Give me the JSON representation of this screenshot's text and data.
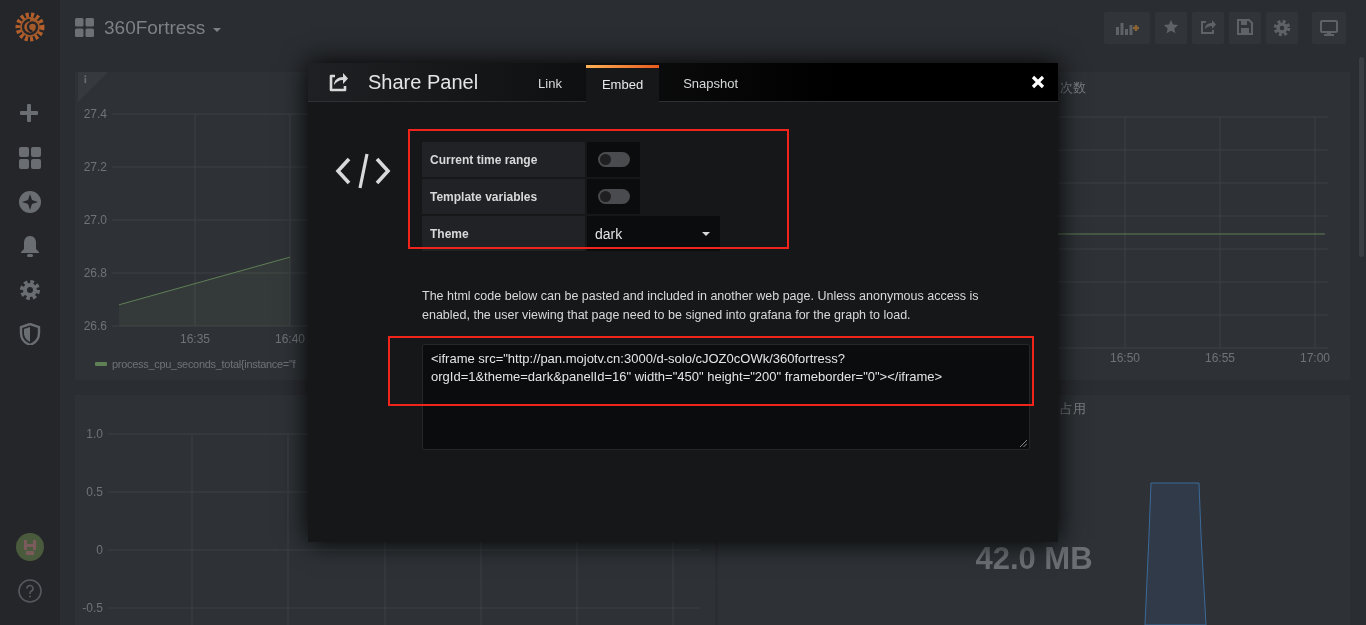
{
  "navbar": {
    "dashboard_title": "360Fortress"
  },
  "panels": [
    {
      "kind": "graph",
      "chart_data": {
        "type": "area",
        "grid": true,
        "ylim": [
          26.6,
          27.4
        ],
        "categories": [
          null,
          null,
          null,
          null,
          "16:35",
          null,
          null,
          null,
          null,
          "16:40",
          null
        ],
        "yticks": [
          {
            "value": 26.6,
            "label": "26.6"
          },
          {
            "value": 26.8,
            "label": "26.8"
          },
          {
            "value": 27.0,
            "label": "27.0"
          },
          {
            "value": 27.2,
            "label": "27.2"
          },
          {
            "value": 27.4,
            "label": "27.4"
          }
        ],
        "series": [
          {
            "name": "process_cpu_seconds_total{instance=\"f",
            "color": "#5f7f55",
            "values": [
              26.68,
              26.7,
              26.72,
              26.74,
              26.76,
              26.78,
              26.8,
              26.82,
              26.84,
              26.86,
              null
            ]
          }
        ]
      }
    },
    {
      "kind": "graph_picture",
      "title": "次数",
      "x_tick_labels": [
        "16:50",
        "16:55",
        "17:00"
      ]
    },
    {
      "kind": "empty_graph",
      "y_tick_labels": [
        "1.0",
        "0.5",
        "0",
        "-0.5"
      ]
    },
    {
      "kind": "singlestat",
      "title": "占用",
      "value": "42.0 MB"
    }
  ],
  "share_modal": {
    "title": "Share Panel",
    "tabs": [
      {
        "label": "Link",
        "selected": false
      },
      {
        "label": "Embed",
        "selected": true
      },
      {
        "label": "Snapshot",
        "selected": false
      }
    ],
    "options": [
      {
        "kind": "switch",
        "label": "Current time range",
        "on": false
      },
      {
        "kind": "switch",
        "label": "Template variables",
        "on": false
      },
      {
        "kind": "select",
        "label": "Theme",
        "value": "dark"
      }
    ],
    "description": "The html code below can be pasted and included in another web page. Unless anonymous access is enabled, the user viewing that page need to be signed into grafana for the graph to load.",
    "embed_code": "<iframe src=\"http://pan.mojotv.cn:3000/d-solo/cJOZ0cOWk/360fortress?orgId=1&theme=dark&panelId=16\" width=\"450\" height=\"200\" frameborder=\"0\"></iframe>",
    "highlights": {
      "options": true,
      "embed_code": true
    }
  }
}
